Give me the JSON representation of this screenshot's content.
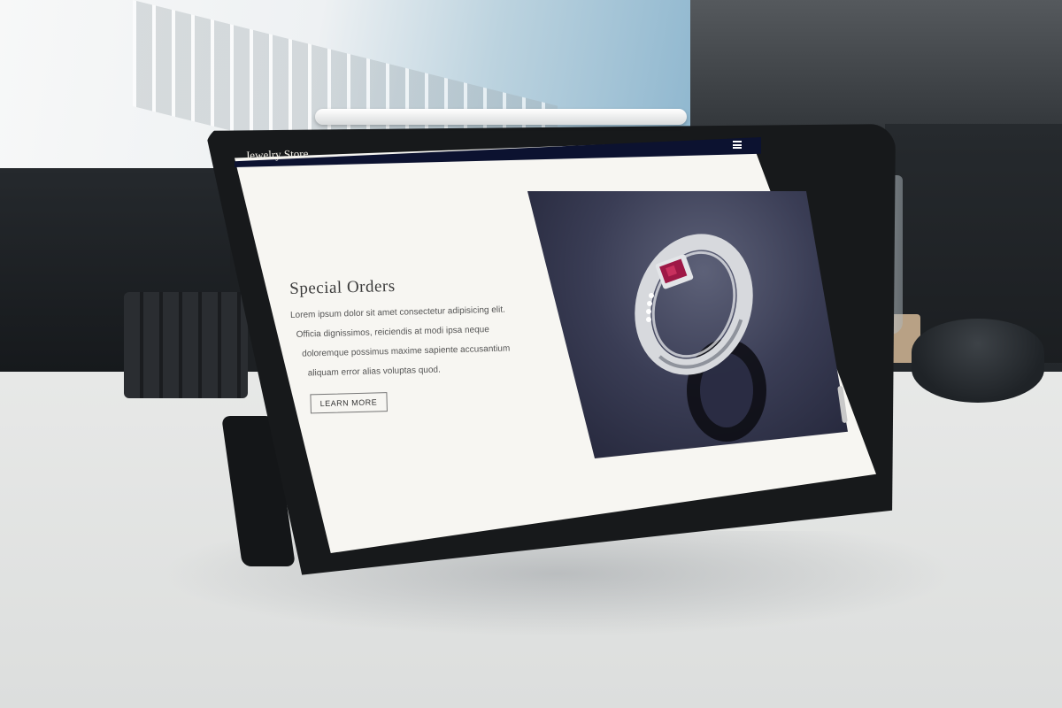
{
  "navbar": {
    "brand": "Jewelry Store",
    "menu_icon": "hamburger-menu-icon",
    "bg_color": "#0c1230"
  },
  "hero": {
    "heading": "Special Orders",
    "paragraph_lines": [
      "Lorem ipsum dolor sit amet consectetur adipisicing elit.",
      "Officia dignissimos, reiciendis at modi ipsa neque",
      "doloremque possimus maxime sapiente accusantium",
      "aliquam error alias voluptas quod."
    ],
    "cta_label": "LEARN MORE",
    "image_subject": "ring-with-red-gemstone"
  },
  "colors": {
    "page_bg": "#f7f6f2",
    "text": "#555555",
    "gem": "#9e1846"
  }
}
